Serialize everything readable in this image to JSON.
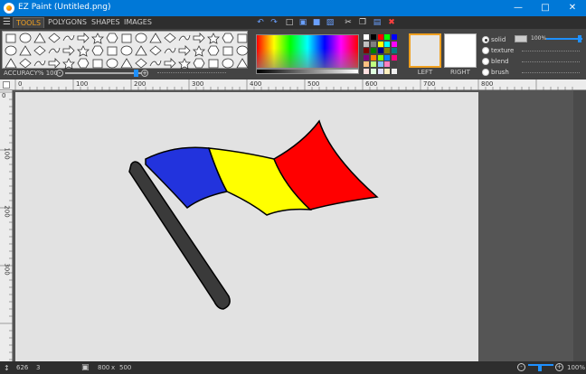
{
  "window": {
    "title": "EZ Paint (Untitled.png)"
  },
  "menu": {
    "tabs": [
      {
        "label": "TOOLS",
        "active": true
      },
      {
        "label": "POLYGONS",
        "active": false
      },
      {
        "label": "SHAPES",
        "active": false
      },
      {
        "label": "IMAGES",
        "active": false
      }
    ],
    "toolbar_icons": [
      "undo-icon",
      "redo-icon",
      "new-file-icon",
      "open-file-icon",
      "save-icon",
      "save-as-icon",
      "cut-icon",
      "copy-icon",
      "paste-icon",
      "delete-icon"
    ]
  },
  "tools": {
    "accuracy_label": "ACCURACY% 100",
    "accuracy_value": 100
  },
  "colors": {
    "left_label": "LEFT",
    "right_label": "RIGHT",
    "left": "#e6e6e6",
    "right": "#ffffff",
    "accent": "#f0a020",
    "swatches": [
      "#ffffff",
      "#000000",
      "#ff0000",
      "#00ff00",
      "#0000ff",
      "#c0c0c0",
      "#808080",
      "#ffff00",
      "#00ffff",
      "#ff00ff",
      "#800000",
      "#008000",
      "#000080",
      "#808000",
      "#008080",
      "#800080",
      "#ff8000",
      "#80ff00",
      "#0080ff",
      "#ff0080",
      "#ffc080",
      "#c0ff80",
      "#80c0ff",
      "#ff80c0",
      "#404040",
      "#ffe0e0",
      "#e0ffe0",
      "#e0e0ff",
      "#fff0c0",
      "#f0f0f0"
    ],
    "palette_strip": [
      "#000000",
      "#ffffff",
      "#ff8800",
      "#2b6cff",
      "#ff3300",
      "#ffd000",
      "#b0b0b0",
      "#c8a060",
      "#ff6600",
      "#00aaff",
      "#ff2222",
      "#99ff33",
      "#ee0000",
      "#d0d0d0",
      "#bb8844"
    ]
  },
  "fill": {
    "options": [
      {
        "label": "solid",
        "selected": true
      },
      {
        "label": "texture",
        "selected": false
      },
      {
        "label": "blend",
        "selected": false
      },
      {
        "label": "brush",
        "selected": false
      }
    ],
    "opacity_label": "100%",
    "opacity_value": 100
  },
  "rulers": {
    "top": [
      "0",
      "100",
      "200",
      "300",
      "400",
      "500",
      "600",
      "700",
      "800"
    ],
    "left": [
      "0",
      "100",
      "200",
      "300"
    ]
  },
  "drawing": {
    "pole_color": "#3a3a3a",
    "stripes": [
      "#2233dd",
      "#ffff00",
      "#ff0000"
    ]
  },
  "status": {
    "cursor_x": "626",
    "cursor_y": "3",
    "canvas_w": "800",
    "canvas_sep": "x",
    "canvas_h": "500",
    "zoom": "100%"
  }
}
